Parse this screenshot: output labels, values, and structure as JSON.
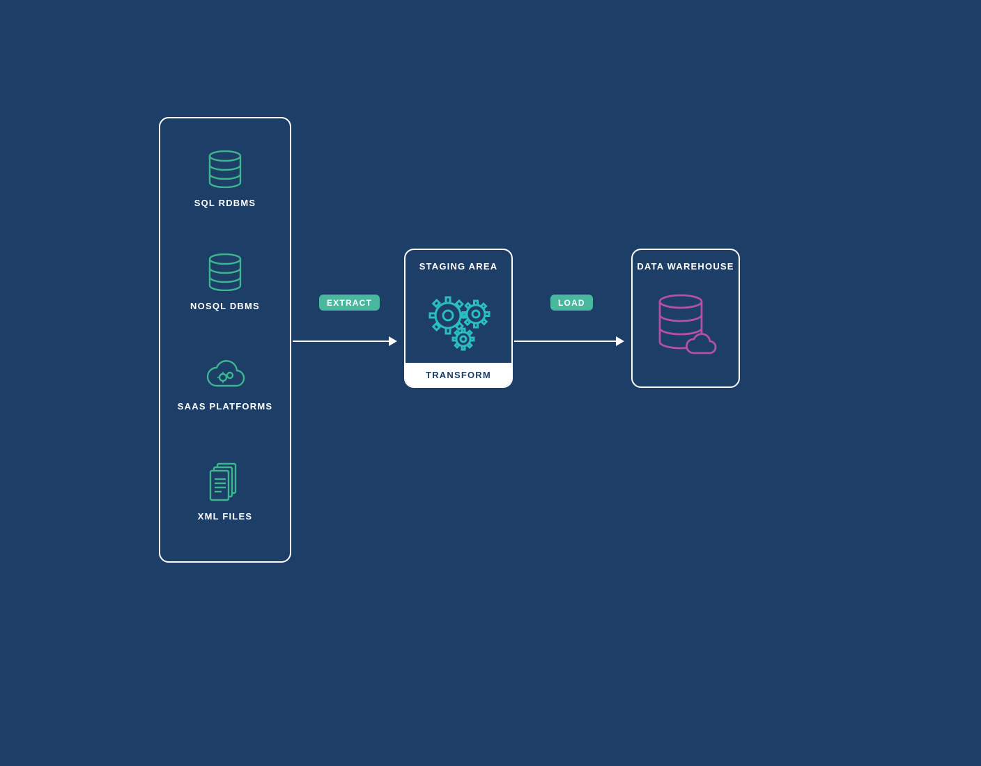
{
  "sources": {
    "items": [
      {
        "label": "SQL RDBMS",
        "icon": "database-icon"
      },
      {
        "label": "NOSQL DBMS",
        "icon": "database-icon"
      },
      {
        "label": "SAAS PLATFORMS",
        "icon": "cloud-gears-icon"
      },
      {
        "label": "XML FILES",
        "icon": "files-icon"
      }
    ]
  },
  "arrows": {
    "extract_label": "EXTRACT",
    "load_label": "LOAD"
  },
  "staging": {
    "title": "STAGING AREA",
    "footer": "TRANSFORM"
  },
  "warehouse": {
    "title": "DATA WAREHOUSE"
  },
  "colors": {
    "background": "#1c3e67",
    "stroke": "#ffffff",
    "source_icon": "#3fb58f",
    "staging_icon": "#2bbdbf",
    "warehouse_icon": "#b451a3",
    "pill_bg": "#4ab89f"
  }
}
